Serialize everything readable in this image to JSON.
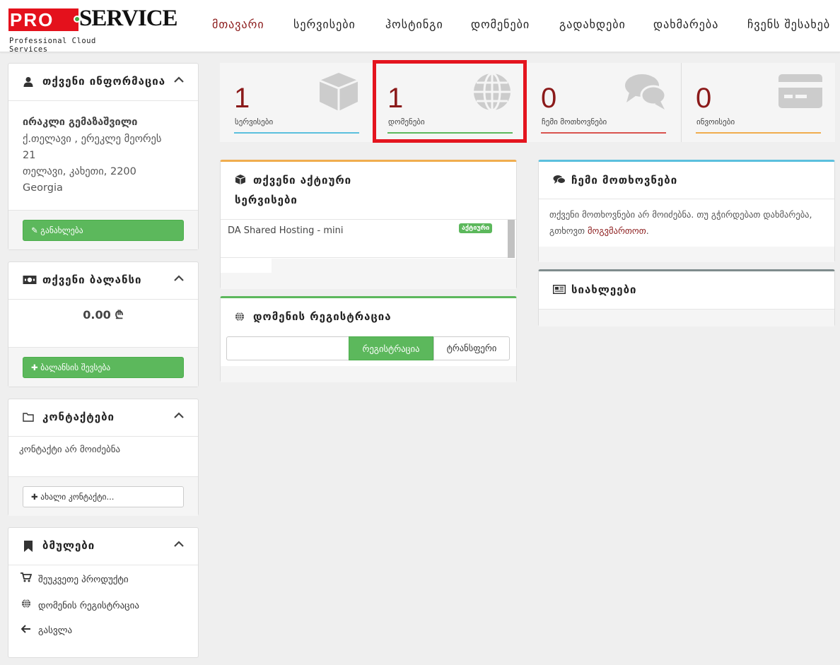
{
  "brand": {
    "logo_pro": "PRO",
    "logo_service": "SERVICE",
    "tagline": "Professional Cloud Services"
  },
  "nav": [
    {
      "label": "მთავარი",
      "active": true
    },
    {
      "label": "სერვისები"
    },
    {
      "label": "ჰოსტინგი"
    },
    {
      "label": "დომენები"
    },
    {
      "label": "გადახდები"
    },
    {
      "label": "დახმარება"
    },
    {
      "label": "ჩვენს შესახებ"
    }
  ],
  "sidebar": {
    "info": {
      "title": "თქვენი ინფორმაცია",
      "name": "ირაკლი გემაზაშვილი",
      "address_line1": "ქ.თელავი , ერეკლე მეორეს",
      "address_line2": "21",
      "address_line3": "თელავი, კახეთი, 2200",
      "country": "Georgia",
      "update_button": "განახლება"
    },
    "balance": {
      "title": "თქვენი ბალანსი",
      "amount": "0.00 ₾",
      "topup_button": "ბალანსის შევსება"
    },
    "contacts": {
      "title": "კონტაქტები",
      "empty": "კონტაქტი არ მოიძებნა",
      "new_button": "ახალი კონტაქტი..."
    },
    "bookmarks": {
      "title": "ბმულები",
      "items": [
        {
          "label": "შეუკვეთე პროდუქტი",
          "icon": "cart-icon"
        },
        {
          "label": "დომენის რეგისტრაცია",
          "icon": "globe-icon"
        },
        {
          "label": "გასვლა",
          "icon": "arrow-left-icon"
        }
      ]
    }
  },
  "stats": [
    {
      "value": "1",
      "label": "სერვისები",
      "color": "#5bc0de",
      "icon": "cube-icon"
    },
    {
      "value": "1",
      "label": "დომენები",
      "color": "#5cb85c",
      "icon": "globe-icon"
    },
    {
      "value": "0",
      "label": "ჩემი მოთხოვნები",
      "color": "#d9534f",
      "icon": "comments-icon"
    },
    {
      "value": "0",
      "label": "ინვოისები",
      "color": "#f0ad4e",
      "icon": "credit-card-icon"
    }
  ],
  "active_services": {
    "title_line1": "თქვენი აქტიური",
    "title_line2": "სერვისები",
    "service_name": "DA Shared Hosting - mini",
    "status": "აქტიური"
  },
  "domain_registration": {
    "title": "დომენის რეგისტრაცია",
    "input_value": "",
    "register_button": "რეგისტრაცია",
    "transfer_button": "ტრანსფერი"
  },
  "tickets": {
    "title": "ჩემი მოთხოვნები",
    "text_before": "თქვენი მოთხოვნები არ მოიძებნა. თუ გჭირდებათ დახმარება, გთხოვთ ",
    "link": "მოგვმართოთ",
    "text_after": "."
  },
  "news": {
    "title": "სიახლეები"
  },
  "colors": {
    "accent": "#8b1a1a",
    "brand_red": "#e4111c",
    "green": "#5cb85c",
    "highlight": "#e4151f"
  }
}
